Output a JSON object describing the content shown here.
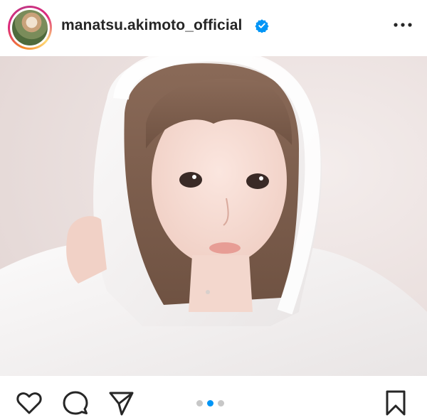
{
  "post": {
    "username": "manatsu.akimoto_official",
    "verified_icon": "verified-badge-icon",
    "more_icon": "more-options-icon"
  },
  "carousel": {
    "total": 3,
    "current": 2
  },
  "actions": {
    "like_icon": "heart-icon",
    "comment_icon": "comment-icon",
    "share_icon": "send-icon",
    "save_icon": "bookmark-icon"
  },
  "colors": {
    "accent": "#0095f6",
    "dot_inactive": "#c7c7c7",
    "text": "#262626"
  }
}
